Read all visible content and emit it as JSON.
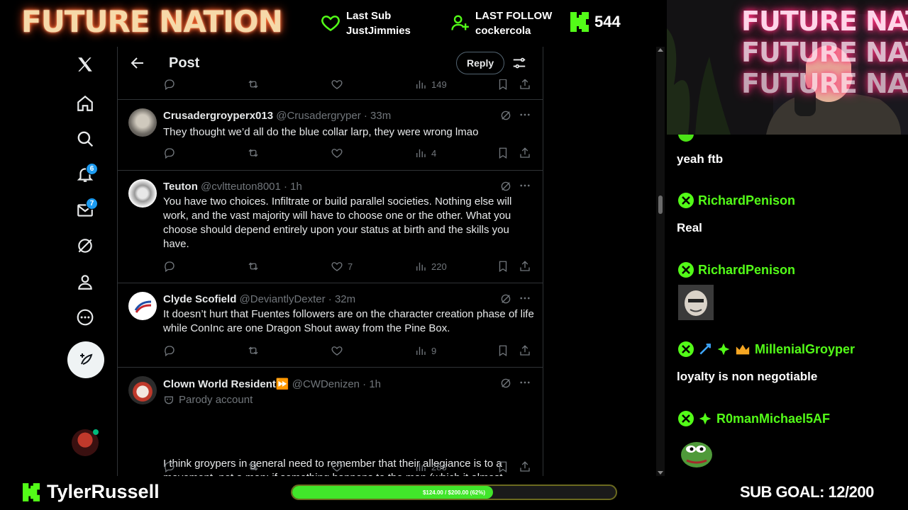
{
  "overlay": {
    "brand_logo": "FUTURE NATION",
    "last_sub": {
      "label": "Last Sub",
      "value": "JustJimmies"
    },
    "last_follow": {
      "label": "LAST FOLLOW",
      "value": "cockercola"
    },
    "kick_viewers": "544",
    "streamer_name": "TylerRussell",
    "progress_text": "$124.00 / $200.00 (62%)",
    "progress_fraction": 0.62,
    "sub_goal": "SUB GOAL: 12/200",
    "accent_color": "#53fc18"
  },
  "nav": {
    "notifications_badge": "6",
    "messages_badge": "7"
  },
  "post_header": {
    "title": "Post",
    "reply_label": "Reply"
  },
  "top_actions": {
    "views": "149"
  },
  "tweets": [
    {
      "name": "Crusadergroyperx013",
      "handle": "@Crusadergryper · 33m",
      "text": "They thought we’d all do the blue collar larp, they were wrong lmao",
      "likes": "",
      "views": "4"
    },
    {
      "name": "Teuton",
      "handle": "@cvltteuton8001 · 1h",
      "text": "You have two choices. Infiltrate or build parallel societies. Nothing else will work, and the vast majority will have to choose one or the other. What you choose should depend entirely upon your status at birth and the skills you have.",
      "likes": "7",
      "views": "220"
    },
    {
      "name": "Clyde Scofield",
      "handle": "@DeviantlyDexter · 32m",
      "text": "It doesn’t hurt that Fuentes followers are on the character creation phase of life while ConInc are one Dragon Shout away from the Pine Box.",
      "likes": "",
      "views": "9"
    },
    {
      "name": "Clown World Resident⏩",
      "handle": "@CWDenizen · 1h",
      "parody": "Parody account",
      "text": "I think groypers in general need to remember that their allegiance is to a movement, not a man; if something happens to the man (which it almost certainly will), you continue with the movement regardless",
      "likes": "",
      "views": "286"
    }
  ],
  "chat": {
    "messages": [
      {
        "user": "",
        "text": "yeah ftb"
      },
      {
        "user": "RichardPenison",
        "text": "Real"
      },
      {
        "user": "RichardPenison",
        "text": ""
      },
      {
        "user": "MillenialGroyper",
        "text": "loyalty is non negotiable"
      },
      {
        "user": "R0manMichael5AF",
        "text": ""
      }
    ]
  }
}
